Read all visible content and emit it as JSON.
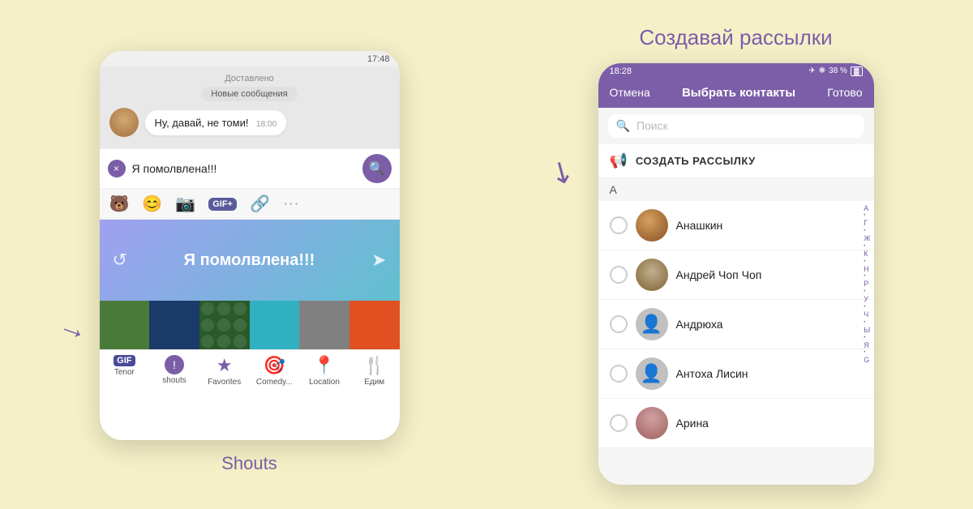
{
  "background_color": "#f5f0c8",
  "left": {
    "status_bar": {
      "time": "17:48",
      "status": "Доставлено"
    },
    "chat": {
      "new_messages_pill": "Новые сообщения",
      "message_text": "Ну, давай, не томи!",
      "message_time": "18:00"
    },
    "input": {
      "text": "Я помолвлена!!!",
      "x_icon": "×"
    },
    "sticker_toolbar_icons": [
      "🐻",
      "😊",
      "📷",
      "GIF+",
      "🔗",
      "···"
    ],
    "sticker_preview_text": "Я помолвлена!!!",
    "sticker_tabs": [
      {
        "icon": "GIF",
        "label": "Tenor"
      },
      {
        "icon": "!",
        "label": "shouts"
      },
      {
        "icon": "★",
        "label": "Favorites"
      },
      {
        "icon": "◎",
        "label": "Comedy..."
      },
      {
        "icon": "📍",
        "label": "Location"
      },
      {
        "icon": "✎",
        "label": "Едим"
      }
    ],
    "label": "Shouts"
  },
  "right": {
    "title": "Создавай рассылки",
    "status_bar": {
      "time": "18:28",
      "icons": "✈ ❋ 38%"
    },
    "header": {
      "cancel": "Отмена",
      "title": "Выбрать контакты",
      "done": "Готово"
    },
    "search_placeholder": "Поиск",
    "create_broadcast": "СОЗДАТЬ РАССЫЛКУ",
    "section_a": "А",
    "contacts": [
      {
        "name": "Анашкин"
      },
      {
        "name": "Андрей Чоп Чоп"
      },
      {
        "name": "Андрюха"
      },
      {
        "name": "Антоха Лисин"
      },
      {
        "name": "Арина"
      }
    ],
    "alpha_index": [
      "А",
      "•",
      "Г",
      "•",
      "Ж",
      "•",
      "К",
      "•",
      "Н",
      "•",
      "Р",
      "•",
      "У",
      "•",
      "Ч",
      "•",
      "Ы",
      "•",
      "Я",
      "•",
      "G"
    ]
  }
}
